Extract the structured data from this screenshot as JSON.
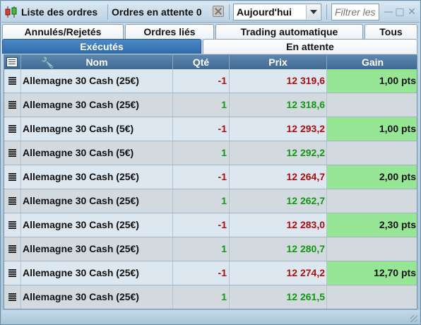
{
  "toolbar": {
    "title": "Liste des ordres",
    "pending_label": "Ordres en attente 0",
    "period_value": "Aujourd'hui",
    "filter_placeholder": "Filtrer les",
    "minimize": "—",
    "maximize": "□",
    "close": "✕"
  },
  "tabs": {
    "row1": [
      "Annulés/Rejetés",
      "Ordres liés",
      "Trading automatique",
      "Tous"
    ],
    "row2": [
      "Exécutés",
      "En attente"
    ],
    "active": "Exécutés"
  },
  "table": {
    "columns": [
      "",
      "",
      "Nom",
      "Qté",
      "Prix",
      "Gain"
    ],
    "rows": [
      {
        "name": "Allemagne 30 Cash (25€)",
        "qty": "-1",
        "price": "12 319,6",
        "gain": "1,00 pts"
      },
      {
        "name": "Allemagne 30 Cash (25€)",
        "qty": "1",
        "price": "12 318,6",
        "gain": ""
      },
      {
        "name": "Allemagne 30 Cash (5€)",
        "qty": "-1",
        "price": "12 293,2",
        "gain": "1,00 pts"
      },
      {
        "name": "Allemagne 30 Cash (5€)",
        "qty": "1",
        "price": "12 292,2",
        "gain": ""
      },
      {
        "name": "Allemagne 30 Cash (25€)",
        "qty": "-1",
        "price": "12 264,7",
        "gain": "2,00 pts"
      },
      {
        "name": "Allemagne 30 Cash (25€)",
        "qty": "1",
        "price": "12 262,7",
        "gain": ""
      },
      {
        "name": "Allemagne 30 Cash (25€)",
        "qty": "-1",
        "price": "12 283,0",
        "gain": "2,30 pts"
      },
      {
        "name": "Allemagne 30 Cash (25€)",
        "qty": "1",
        "price": "12 280,7",
        "gain": ""
      },
      {
        "name": "Allemagne 30 Cash (25€)",
        "qty": "-1",
        "price": "12 274,2",
        "gain": "12,70 pts"
      },
      {
        "name": "Allemagne 30 Cash (25€)",
        "qty": "1",
        "price": "12 261,5",
        "gain": ""
      }
    ]
  },
  "colors": {
    "negative": "#b00d0d",
    "positive": "#0f9a12",
    "gain_highlight": "#96e696",
    "header_bg": "#3f6a95",
    "active_tab": "#2f6aa9"
  },
  "icons": {
    "app": "candlestick-chart-icon",
    "clear": "clear-x-icon",
    "dropdown": "chevron-down-icon",
    "columns": "list-icon",
    "settings": "wrench-icon",
    "row": "document-lines-icon"
  }
}
